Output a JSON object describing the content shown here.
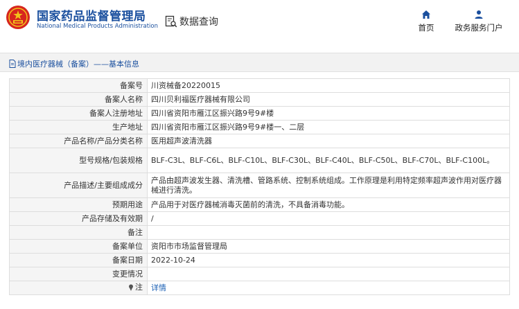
{
  "header": {
    "site_title": "国家药品监督管理局",
    "site_subtitle": "National Medical Products Administration",
    "query_label": "数据查询",
    "nav": [
      {
        "label": "首页",
        "icon": "home-icon"
      },
      {
        "label": "政务服务门户",
        "icon": "person-icon"
      }
    ]
  },
  "breadcrumb": {
    "text": "境内医疗器械（备案）——基本信息",
    "icon": "document-icon"
  },
  "record": {
    "rows": [
      {
        "key": "备案号",
        "value": "川资械备20220015"
      },
      {
        "key": "备案人名称",
        "value": "四川贝利福医疗器械有限公司"
      },
      {
        "key": "备案人注册地址",
        "value": "四川省资阳市雁江区振兴路9号9#楼"
      },
      {
        "key": "生产地址",
        "value": "四川省资阳市雁江区振兴路9号9#楼一、二层"
      },
      {
        "key": "产品名称/产品分类名称",
        "value": "医用超声波清洗器"
      },
      {
        "key": "型号规格/包装规格",
        "value": "BLF-C3L、BLF-C6L、BLF-C10L、BLF-C30L、BLF-C40L、BLF-C50L、BLF-C70L、BLF-C100L。"
      },
      {
        "key": "产品描述/主要组成成分",
        "value": "产品由超声波发生器、清洗槽、管路系统、控制系统组成。工作原理是利用特定频率超声波作用对医疗器械进行清洗。"
      },
      {
        "key": "预期用途",
        "value": "产品用于对医疗器械消毒灭菌前的清洗，不具备消毒功能。"
      },
      {
        "key": "产品存储及有效期",
        "value": "/"
      },
      {
        "key": "备注",
        "value": ""
      },
      {
        "key": "备案单位",
        "value": "资阳市市场监督管理局"
      },
      {
        "key": "备案日期",
        "value": "2022-10-24"
      },
      {
        "key": "变更情况",
        "value": ""
      }
    ],
    "note_key": "注",
    "note_link": "详情"
  },
  "colors": {
    "brand_blue": "#1a4f9e",
    "link_blue": "#1a5fb4",
    "key_bg": "#f5f5f5",
    "border": "#dddddd",
    "logo_red": "#d7261e",
    "logo_gold": "#f2c21b"
  }
}
